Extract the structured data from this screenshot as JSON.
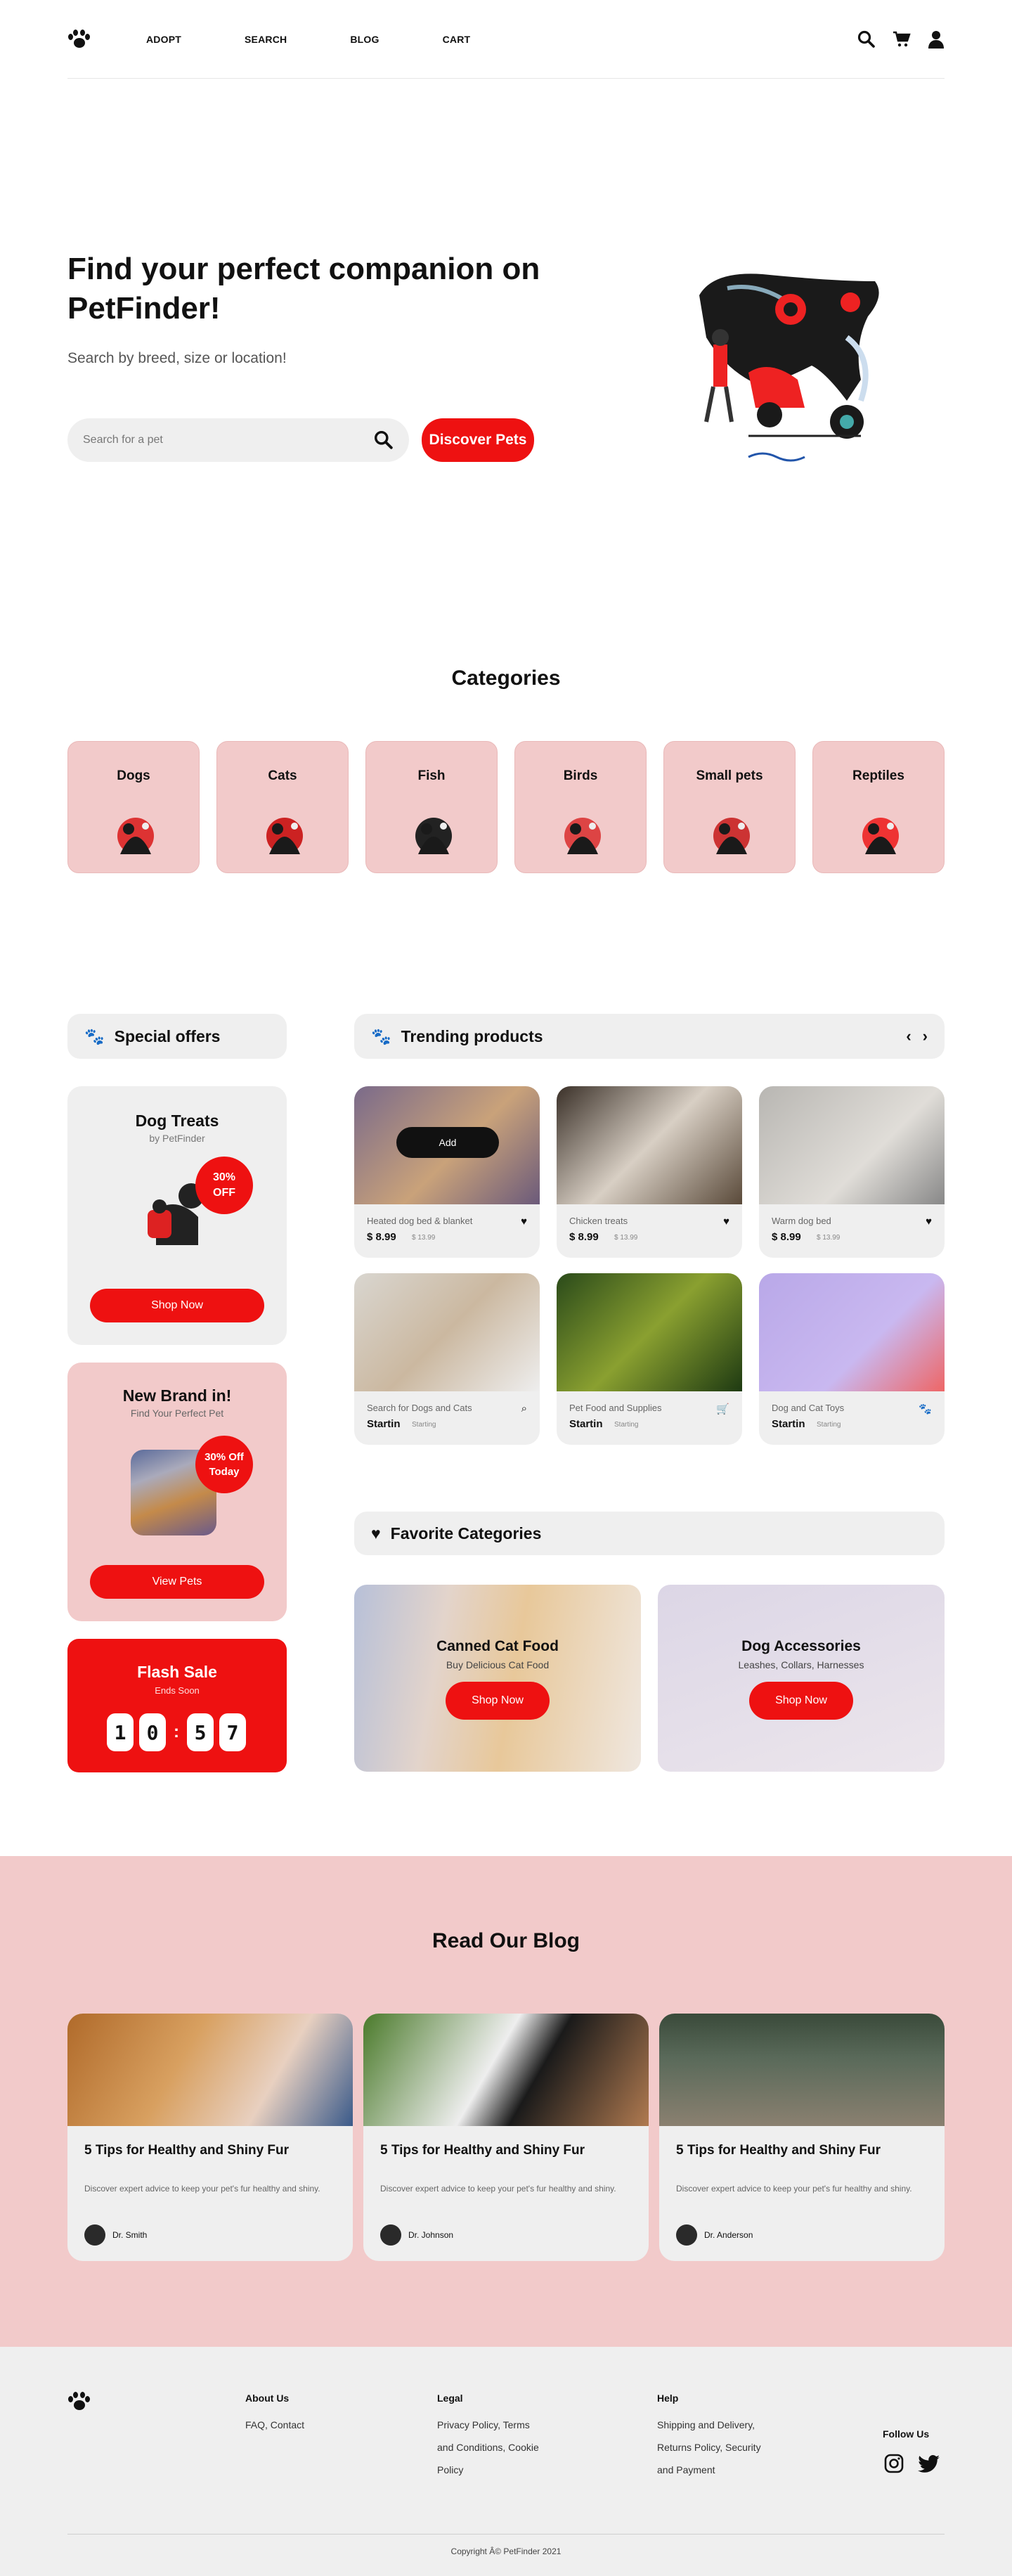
{
  "nav": {
    "links": [
      "ADOPT",
      "SEARCH",
      "BLOG",
      "CART"
    ],
    "icons": [
      "search-icon",
      "cart-icon",
      "user-icon"
    ]
  },
  "hero": {
    "title": "Find your perfect companion on PetFinder!",
    "subtitle": "Search by breed, size or location!",
    "search_placeholder": "Search for a pet",
    "button": "Discover Pets"
  },
  "categories": {
    "title": "Categories",
    "items": [
      "Dogs",
      "Cats",
      "Fish",
      "Birds",
      "Small pets",
      "Reptiles"
    ]
  },
  "special": {
    "title": "Special offers",
    "offer1": {
      "title": "Dog Treats",
      "subtitle": "by PetFinder",
      "badge": "30% OFF",
      "button": "Shop Now"
    },
    "offer2": {
      "title": "New Brand in!",
      "subtitle": "Find Your Perfect Pet",
      "badge": "30% Off Today",
      "button": "View Pets"
    },
    "flash": {
      "title": "Flash Sale",
      "subtitle": "Ends Soon",
      "digits": [
        "1",
        "0",
        "5",
        "7"
      ],
      "sep": ":"
    }
  },
  "trending": {
    "title": "Trending products",
    "add_label": "Add",
    "products": [
      {
        "name": "Heated dog bed & blanket",
        "price": "$ 8.99",
        "old": "$ 13.99",
        "icon": "heart-icon"
      },
      {
        "name": "Chicken treats",
        "price": "$ 8.99",
        "old": "$ 13.99",
        "icon": "heart-icon"
      },
      {
        "name": "Warm dog bed",
        "price": "$ 8.99",
        "old": "$ 13.99",
        "icon": "heart-icon"
      },
      {
        "name": "Search for Dogs and Cats",
        "price": "Startin",
        "old": "Starting",
        "icon": "search-icon"
      },
      {
        "name": "Pet Food and Supplies",
        "price": "Startin",
        "old": "Starting",
        "icon": "cart-icon"
      },
      {
        "name": "Dog and Cat Toys",
        "price": "Startin",
        "old": "Starting",
        "icon": "paw-icon"
      }
    ]
  },
  "favorites": {
    "title": "Favorite Categories",
    "items": [
      {
        "title": "Canned Cat Food",
        "subtitle": "Buy Delicious Cat Food",
        "button": "Shop Now"
      },
      {
        "title": "Dog Accessories",
        "subtitle": "Leashes, Collars, Harnesses",
        "button": "Shop Now"
      }
    ]
  },
  "blog": {
    "title": "Read Our Blog",
    "posts": [
      {
        "title": "5 Tips for Healthy and Shiny Fur",
        "desc": "Discover expert advice to keep your pet's fur healthy and shiny.",
        "author": "Dr. Smith"
      },
      {
        "title": "5 Tips for Healthy and Shiny Fur",
        "desc": "Discover expert advice to keep your pet's fur healthy and shiny.",
        "author": "Dr. Johnson"
      },
      {
        "title": "5 Tips for Healthy and Shiny Fur",
        "desc": "Discover expert advice to keep your pet's fur healthy and shiny.",
        "author": "Dr. Anderson"
      }
    ]
  },
  "footer": {
    "about": {
      "title": "About Us",
      "lines": [
        "FAQ, Contact"
      ]
    },
    "legal": {
      "title": "Legal",
      "lines": [
        "Privacy Policy, Terms",
        "and Conditions, Cookie",
        "Policy"
      ]
    },
    "help": {
      "title": "Help",
      "lines": [
        "Shipping and Delivery,",
        "Returns Policy, Security",
        "and Payment"
      ]
    },
    "follow": "Follow Us",
    "copyright": "Copyright Â© PetFinder 2021"
  },
  "colors": {
    "accent": "#ee1111",
    "pink": "#f2caca",
    "gray": "#efefef"
  }
}
